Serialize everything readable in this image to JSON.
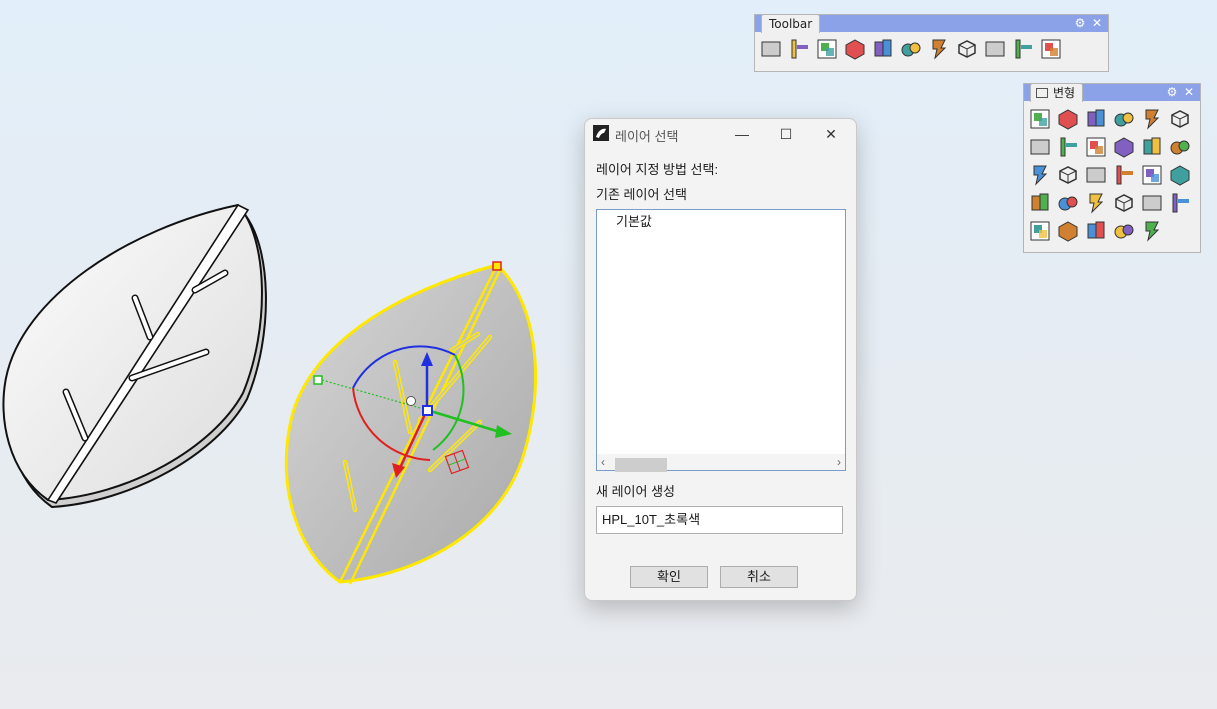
{
  "toolbar1": {
    "tab_label": "Toolbar",
    "icons": [
      "box-icon",
      "dimension-icon",
      "layer-panel-icon",
      "solid-box-icon",
      "copy-layers-icon",
      "find-binoculars-icon",
      "red-bolt-icon",
      "export-cube-icon",
      "folder-icon",
      "notepad-icon",
      "render-sphere-icon"
    ]
  },
  "toolbar2": {
    "tab_label": "변형",
    "icons": [
      "move-icon",
      "copy-icon",
      "rotate-icon",
      "array-icon",
      "scale-icon",
      "box-edit-icon",
      "mirror-icon",
      "orient-icon",
      "sphere-align-icon",
      "set-point-icon",
      "project-icon",
      "shear-icon",
      "move-uvn-icon",
      "grid-array-icon",
      "polar-array-icon",
      "flow-icon",
      "pipe-icon",
      "stretch-icon",
      "twist-icon",
      "bend-icon",
      "taper-icon",
      "smooth-icon",
      "flatten-icon",
      "wave-icon",
      "cage-edit-icon",
      "cylinder-icon",
      "keep-icon",
      "point-lift-icon",
      "red-arrow-icon"
    ]
  },
  "dialog": {
    "title": "레이어 선택",
    "method_label": "레이어 지정 방법 선택:",
    "existing_label": "기존 레이어 선택",
    "layers": [
      "기본값"
    ],
    "new_label": "새 레이어 생성",
    "new_layer_value": "HPL_10T_초록색",
    "ok_label": "확인",
    "cancel_label": "취소",
    "minimize_glyph": "—",
    "maximize_glyph": "☐",
    "close_glyph": "✕",
    "scroll_left_glyph": "‹",
    "scroll_right_glyph": "›"
  },
  "colors": {
    "selection": "#ffe800",
    "gumball_x": "#e02020",
    "gumball_y": "#20c020",
    "gumball_z": "#2030e0",
    "toolbar_header": "#8ca2e8"
  }
}
